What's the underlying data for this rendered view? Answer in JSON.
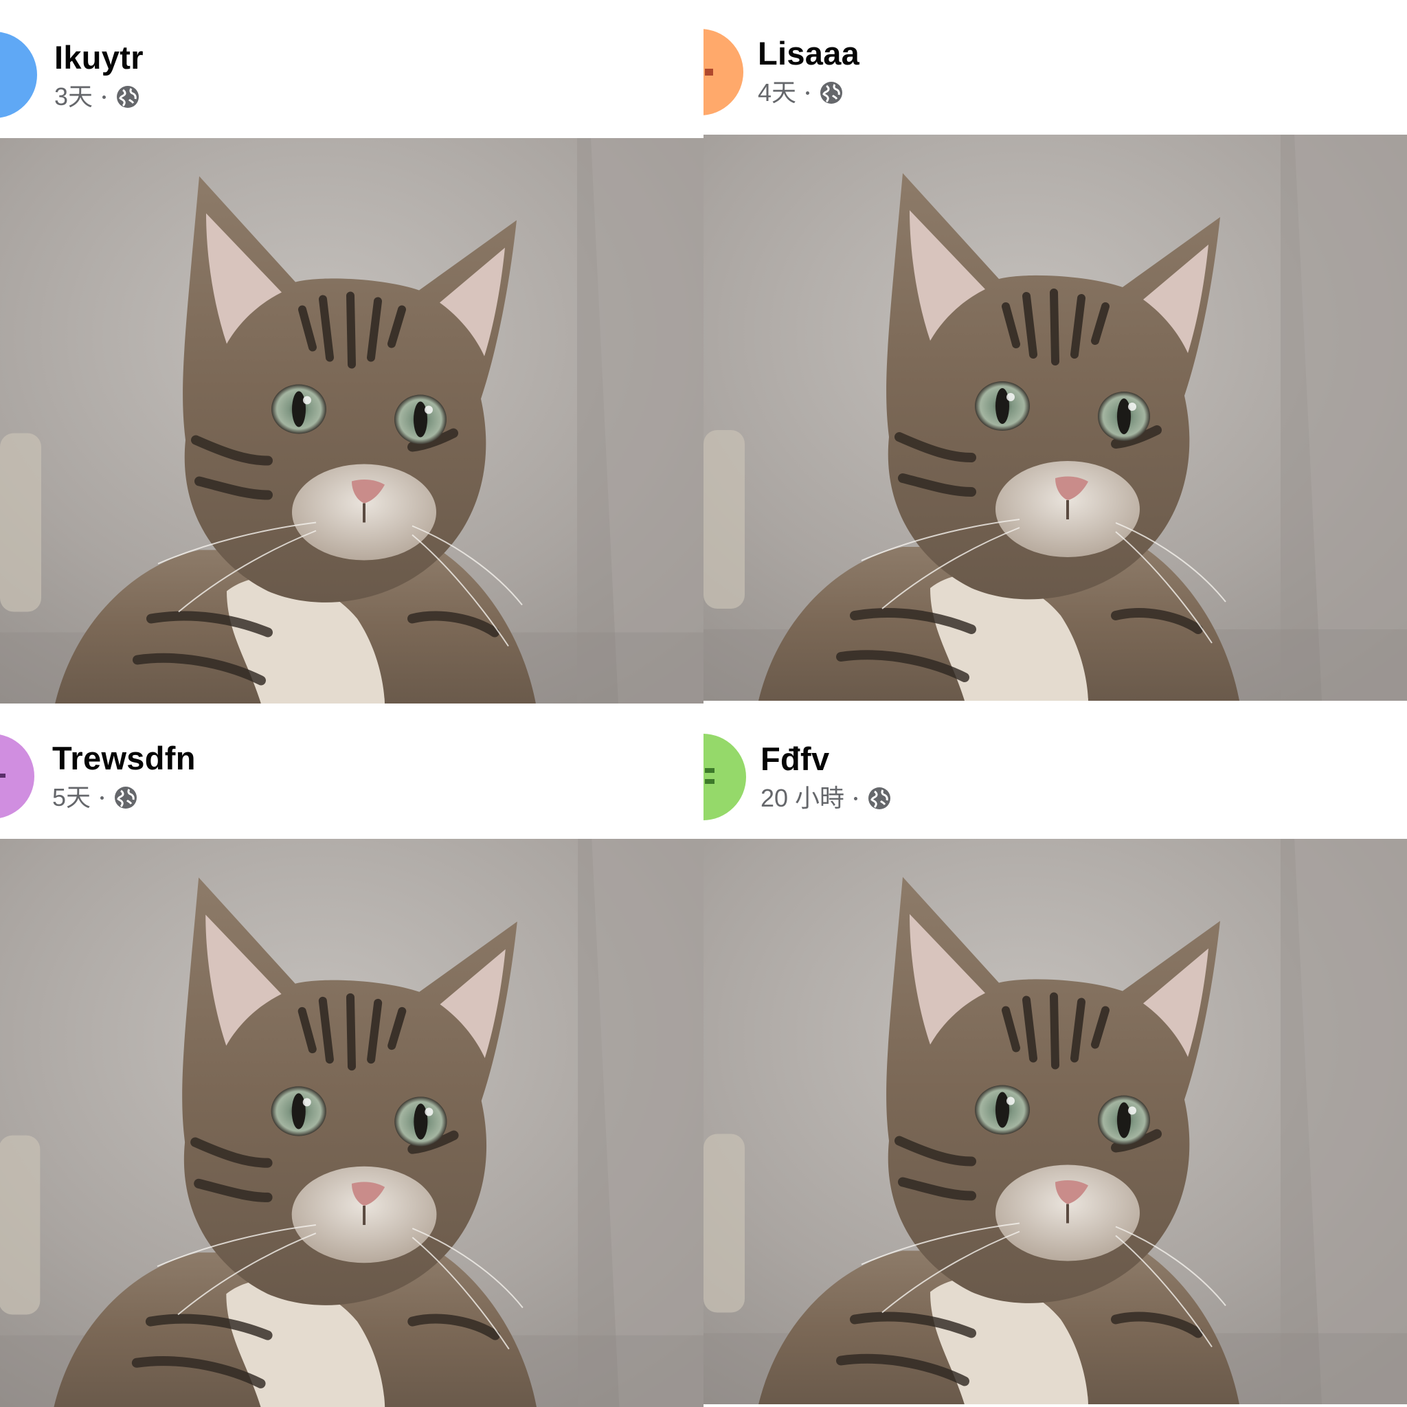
{
  "feed": {
    "posts": [
      {
        "author": "Ikuytr",
        "time": "3天",
        "audience_icon": "globe-icon",
        "avatar_color": "#5fa8f5",
        "photo_subject": "tabby-cat-photo"
      },
      {
        "author": "Lisaaa",
        "time": "4天",
        "audience_icon": "globe-icon",
        "avatar_color": "#ffa96b",
        "photo_subject": "tabby-cat-photo"
      },
      {
        "author": "Trewsdfn",
        "time": "5天",
        "audience_icon": "globe-icon",
        "avatar_color": "#d08ee0",
        "photo_subject": "tabby-cat-photo"
      },
      {
        "author": "Fđfv",
        "time": "20 小時",
        "audience_icon": "globe-icon",
        "avatar_color": "#95d96a",
        "photo_subject": "tabby-cat-photo"
      }
    ]
  },
  "colors": {
    "name_text": "#050505",
    "meta_text": "#65676b",
    "photo_background": "#a6a19d"
  }
}
